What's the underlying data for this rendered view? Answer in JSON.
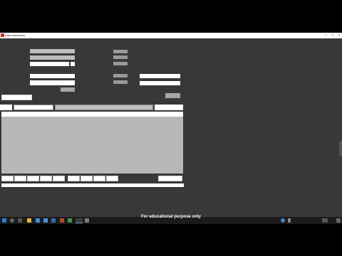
{
  "window": {
    "title": "Data Immersion",
    "minimize": "–",
    "maximize": "□",
    "close": "×"
  },
  "caption": "For educational purpose only",
  "taskbar": {
    "icons": [
      "start-icon",
      "search-icon",
      "task-view-icon",
      "explorer-icon",
      "edge-icon",
      "store-icon",
      "mail-icon",
      "media-icon",
      "app-icon",
      "active-app-icon"
    ],
    "clock": ""
  },
  "colors": {
    "window_bg": "#383838",
    "field_white": "#ffffff",
    "field_grey": "#bdbdbd",
    "grid_grey": "#b8b8b8",
    "taskbar": "#1b1b1b"
  }
}
